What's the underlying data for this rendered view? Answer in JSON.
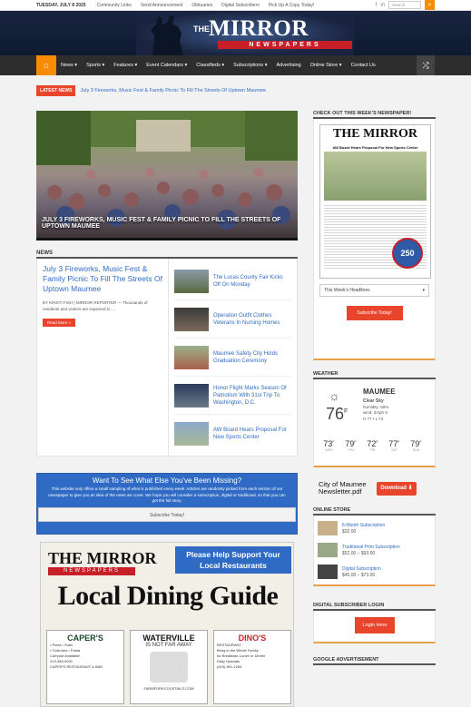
{
  "topbar": {
    "date": "TUESDAY, JULY 8 2025",
    "links": [
      "Community Links",
      "Send Announcement",
      "Obituaries",
      "Digital Subscribers",
      "Pick Up A Copy Today!"
    ],
    "search_placeholder": "Search",
    "social": [
      "f",
      "in"
    ]
  },
  "logo": {
    "the": "THE",
    "name": "MIRROR",
    "sub": "NEWSPAPERS"
  },
  "nav": {
    "items": [
      "News",
      "Sports",
      "Features",
      "Event Calendars",
      "Classifieds",
      "Subscriptions",
      "Advertising",
      "Online Store",
      "Contact Us"
    ]
  },
  "latest": {
    "tag": "LATEST NEWS",
    "headline": "July 3 Fireworks, Music Fest & Family Picnic To Fill The Streets Of Uptown Maumee"
  },
  "hero": {
    "caption": "JULY 3 FIREWORKS, MUSIC FEST & FAMILY PICNIC TO FILL THE STREETS OF UPTOWN MAUMEE"
  },
  "news": {
    "title": "NEWS",
    "lead": {
      "title": "July 3 Fireworks, Music Fest & Family Picnic To Fill The Streets Of Uptown Maumee",
      "snippet": "BY KRISTI FISH | MIRROR REPORTER — Thousands of residents and visitors are expected to …",
      "more": "Read More »"
    },
    "items": [
      "The Lucas County Fair Kicks Off On Monday",
      "Operation Outfit Clothes Veterans In Nursing Homes",
      "Maumee Safety City Holds Graduation Ceremony",
      "Honor Flight Marks Season Of Patriotism With 31st Trip To Washington, D.C.",
      "AW Board Hears Proposal For New Sports Center"
    ]
  },
  "promo": {
    "headline": "Want To See What Else You've Been Missing?",
    "body": "This website only offers a small sampling of what is published every week. Articles are randomly picked from each section of our newspaper to give you an idea of the news we cover. We hope you will consider a subscription, digital or traditional, so that you can get the full story.",
    "button": "Subscribe Today!"
  },
  "dining": {
    "logo": "THE MIRROR",
    "logo_sub": "NEWSPAPERS",
    "plea": "Please Help Support Your Local Restaurants",
    "title": "Local Dining Guide",
    "cards": [
      {
        "name": "CAPER'S",
        "lines": [
          "• Pizza • Subs",
          "• Calzones • Pasta",
          "Carryout Available!",
          "419-389-9000",
          "CAPER'S RESTAURANT & BAR"
        ]
      },
      {
        "name": "WATERVILLE",
        "lines": [
          "IS NOT FAR AWAY",
          "FARMFORKCOCKTAILS.COM"
        ]
      },
      {
        "name": "DINO'S",
        "lines": [
          "RESTAURANT",
          "Bring in the Whole Family",
          "for Breakfast, Lunch or Dinner",
          "Daily Specials",
          "(419) 891-1283"
        ]
      }
    ]
  },
  "sidebar": {
    "paper_title": "CHECK OUT THIS WEEK'S NEWSPAPER!",
    "paper": {
      "name": "THE MIRROR",
      "headline": "AW Board Hears Proposal For New Sports Center",
      "seal": "250"
    },
    "headlines_select": "This Week's Headlines",
    "subscribe": "Subscribe Today!",
    "weather_title": "WEATHER",
    "weather": {
      "city": "MAUMEE",
      "condition": "Clear Sky",
      "humidity": "humidity: 68%",
      "wind": "wind: 2mph S",
      "hilo": "H 77 • L 74",
      "temp": "76",
      "unit": "F",
      "forecast": [
        {
          "day": "WED",
          "t": "73"
        },
        {
          "day": "THU",
          "t": "79"
        },
        {
          "day": "FRI",
          "t": "72"
        },
        {
          "day": "SAT",
          "t": "77"
        },
        {
          "day": "SUN",
          "t": "79"
        }
      ]
    },
    "newsletter": {
      "text": "City of Maumee Newsletter.pdf",
      "download": "Download"
    },
    "store_title": "ONLINE STORE",
    "store": [
      {
        "name": "6-Month Subscription",
        "price": "$32.00"
      },
      {
        "name": "Traditional Print Subscription",
        "price": "$52.00 – $93.00"
      },
      {
        "name": "Digital Subscription",
        "price": "$45.00 – $73.00"
      }
    ],
    "login_title": "DIGITAL SUBSCRIBER LOGIN",
    "login_btn": "Login Here",
    "ad_title": "GOOGLE ADVERTISEMENT"
  }
}
